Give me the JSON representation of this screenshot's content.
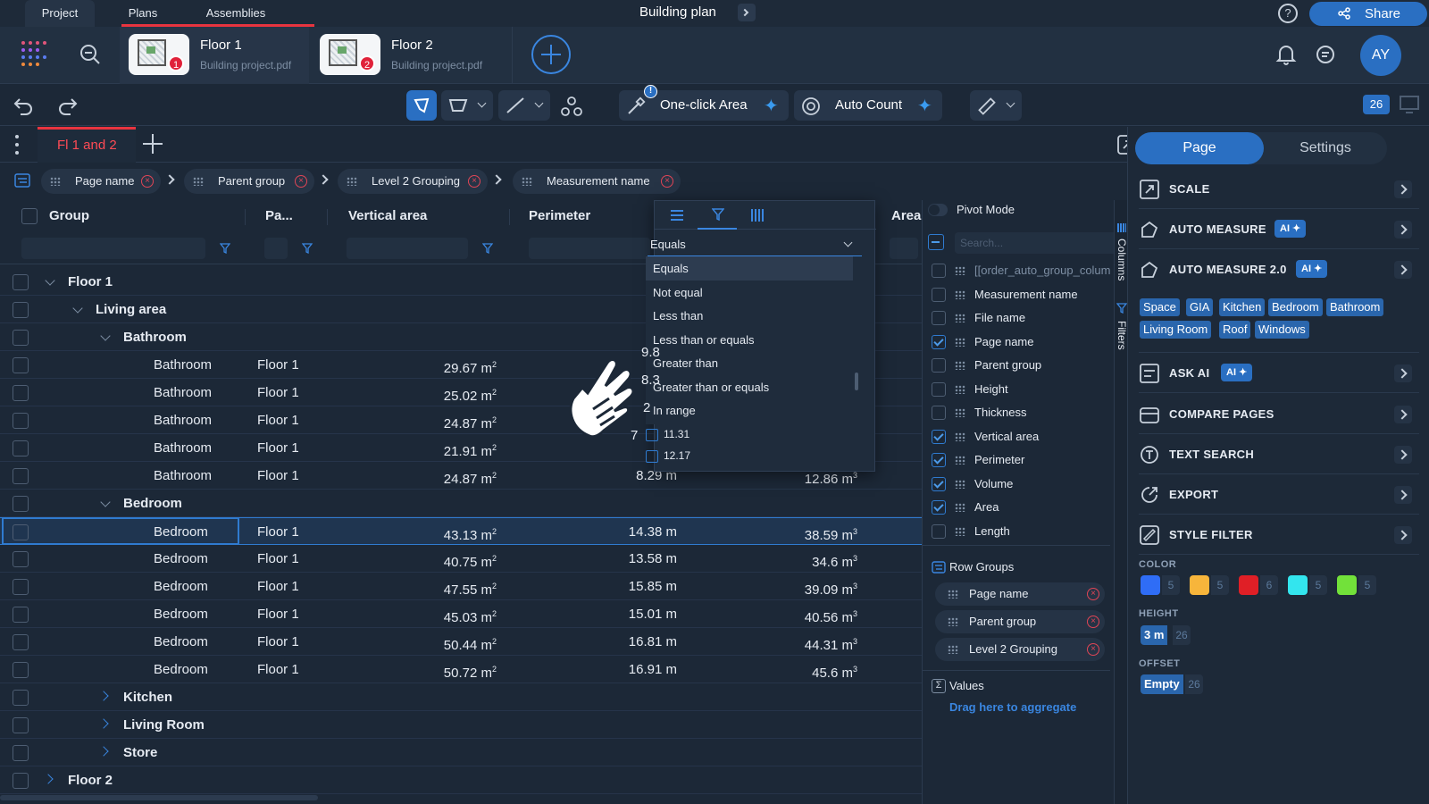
{
  "top": {
    "tabs": [
      "Project",
      "Plans",
      "Assemblies"
    ],
    "title": "Building plan",
    "share_label": "Share",
    "avatar": "AY"
  },
  "pages": [
    {
      "title": "Floor 1",
      "file": "Building project.pdf",
      "badge": "1"
    },
    {
      "title": "Floor 2",
      "file": "Building project.pdf",
      "badge": "2"
    }
  ],
  "toolbar": {
    "oneclick_label": "One-click Area",
    "oneclick_badge": "!",
    "autocount_label": "Auto Count",
    "page_count": "26"
  },
  "view_tab": {
    "label": "Fl 1 and 2"
  },
  "row_groups_bar": [
    "Page name",
    "Parent group",
    "Level 2 Grouping",
    "Measurement name"
  ],
  "grid": {
    "headers": [
      "Group",
      "Pa...",
      "Vertical area",
      "Perimeter",
      "Area"
    ],
    "rows": [
      {
        "kind": "group",
        "level": 0,
        "label": "Floor 1",
        "expanded": true
      },
      {
        "kind": "group",
        "level": 1,
        "label": "Living area",
        "expanded": true
      },
      {
        "kind": "group",
        "level": 2,
        "label": "Bathroom",
        "expanded": true
      },
      {
        "kind": "leaf",
        "name": "Bathroom",
        "page": "Floor 1",
        "varea": "29.67 m",
        "perim": "",
        "area": ""
      },
      {
        "kind": "leaf",
        "name": "Bathroom",
        "page": "Floor 1",
        "varea": "25.02 m",
        "perim": "",
        "area": ""
      },
      {
        "kind": "leaf",
        "name": "Bathroom",
        "page": "Floor 1",
        "varea": "24.87 m",
        "perim": "",
        "area": ""
      },
      {
        "kind": "leaf",
        "name": "Bathroom",
        "page": "Floor 1",
        "varea": "21.91 m",
        "perim": "",
        "area": ""
      },
      {
        "kind": "leaf",
        "name": "Bathroom",
        "page": "Floor 1",
        "varea": "24.87 m",
        "perim": "8.29 m",
        "area": "12.86 m"
      },
      {
        "kind": "group",
        "level": 2,
        "label": "Bedroom",
        "expanded": true
      },
      {
        "kind": "leaf",
        "name": "Bedroom",
        "page": "Floor 1",
        "varea": "43.13 m",
        "perim": "14.38 m",
        "area": "38.59 m",
        "selected": true
      },
      {
        "kind": "leaf",
        "name": "Bedroom",
        "page": "Floor 1",
        "varea": "40.75 m",
        "perim": "13.58 m",
        "area": "34.6 m"
      },
      {
        "kind": "leaf",
        "name": "Bedroom",
        "page": "Floor 1",
        "varea": "47.55 m",
        "perim": "15.85 m",
        "area": "39.09 m"
      },
      {
        "kind": "leaf",
        "name": "Bedroom",
        "page": "Floor 1",
        "varea": "45.03 m",
        "perim": "15.01 m",
        "area": "40.56 m"
      },
      {
        "kind": "leaf",
        "name": "Bedroom",
        "page": "Floor 1",
        "varea": "50.44 m",
        "perim": "16.81 m",
        "area": "44.31 m"
      },
      {
        "kind": "leaf",
        "name": "Bedroom",
        "page": "Floor 1",
        "varea": "50.72 m",
        "perim": "16.91 m",
        "area": "45.6 m"
      },
      {
        "kind": "group",
        "level": 2,
        "label": "Kitchen",
        "expanded": false
      },
      {
        "kind": "group",
        "level": 2,
        "label": "Living Room",
        "expanded": false
      },
      {
        "kind": "group",
        "level": 2,
        "label": "Store",
        "expanded": false
      },
      {
        "kind": "group",
        "level": 0,
        "label": "Floor 2",
        "expanded": false
      }
    ]
  },
  "filter_menu": {
    "selected": "Equals",
    "options": [
      "Equals",
      "Not equal",
      "Less than",
      "Less than or equals",
      "Greater than",
      "Greater than or equals",
      "In range"
    ],
    "values": [
      "11.31",
      "12.17"
    ],
    "partial_values": [
      "9.8",
      "8.3",
      "2",
      "7"
    ]
  },
  "columns_panel": {
    "pivot_label": "Pivot Mode",
    "search_placeholder": "Search...",
    "columns": [
      {
        "label": "[[order_auto_group_colum",
        "checked": false
      },
      {
        "label": "Measurement name",
        "checked": false
      },
      {
        "label": "File name",
        "checked": false
      },
      {
        "label": "Page name",
        "checked": true
      },
      {
        "label": "Parent group",
        "checked": false
      },
      {
        "label": "Height",
        "checked": false
      },
      {
        "label": "Thickness",
        "checked": false
      },
      {
        "label": "Vertical area",
        "checked": true
      },
      {
        "label": "Perimeter",
        "checked": true
      },
      {
        "label": "Volume",
        "checked": true
      },
      {
        "label": "Area",
        "checked": true
      },
      {
        "label": "Length",
        "checked": false
      }
    ],
    "row_groups_title": "Row Groups",
    "row_groups": [
      "Page name",
      "Parent group",
      "Level 2 Grouping"
    ],
    "values_title": "Values",
    "values_hint": "Drag here to aggregate",
    "side_tabs": [
      "Columns",
      "Filters"
    ]
  },
  "right": {
    "tabs": [
      "Page",
      "Settings"
    ],
    "sections": [
      "SCALE",
      "AUTO MEASURE",
      "AUTO MEASURE 2.0",
      "ASK AI",
      "COMPARE PAGES",
      "TEXT SEARCH",
      "EXPORT",
      "STYLE FILTER"
    ],
    "ai_label": "AI",
    "tags": [
      "Space",
      "GIA",
      "Kitchen",
      "Bedroom",
      "Bathroom",
      "Living Room",
      "Roof",
      "Windows"
    ],
    "color_label": "COLOR",
    "colors": [
      {
        "hex": "#2f6df6",
        "count": "5"
      },
      {
        "hex": "#f7b53b",
        "count": "5"
      },
      {
        "hex": "#e01f26",
        "count": "6"
      },
      {
        "hex": "#33e5ee",
        "count": "5"
      },
      {
        "hex": "#72e13a",
        "count": "5"
      }
    ],
    "height_label": "HEIGHT",
    "height_value": "3 m",
    "height_count": "26",
    "offset_label": "OFFSET",
    "offset_value": "Empty",
    "offset_count": "26"
  }
}
